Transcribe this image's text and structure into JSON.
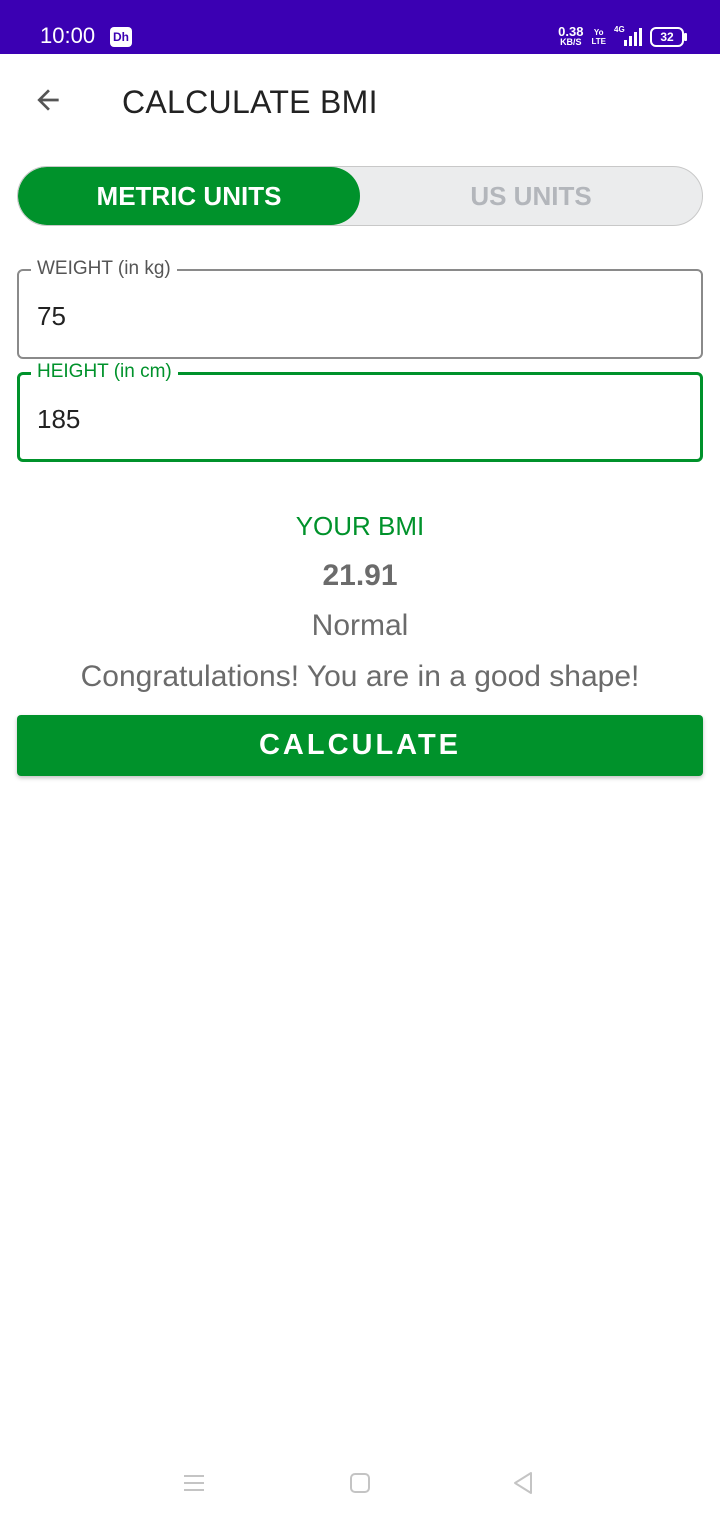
{
  "status_bar": {
    "time": "10:00",
    "app_icon_text": "Dh",
    "net_speed_value": "0.38",
    "net_speed_unit": "KB/S",
    "volte_top": "Yo",
    "volte_bottom": "LTE",
    "network_type": "4G",
    "battery_level": "32",
    "background_color": "#3b00b3"
  },
  "toolbar": {
    "back_icon": "arrow-left-icon",
    "title": "CALCULATE BMI"
  },
  "unit_toggle": {
    "options": [
      {
        "label": "METRIC UNITS",
        "selected": true
      },
      {
        "label": "US UNITS",
        "selected": false
      }
    ],
    "accent_color": "#00922b"
  },
  "weight_field": {
    "label": "WEIGHT (in kg)",
    "value": "75"
  },
  "height_field": {
    "label": "HEIGHT (in cm)",
    "value": "185",
    "focused": true
  },
  "result": {
    "heading": "YOUR BMI",
    "value": "21.91",
    "type": "Normal",
    "description": "Congratulations! You are in a good shape!"
  },
  "calculate_button": {
    "label": "CALCULATE"
  },
  "nav_bar": {
    "items": [
      "menu-icon",
      "home-icon",
      "back-icon"
    ]
  }
}
